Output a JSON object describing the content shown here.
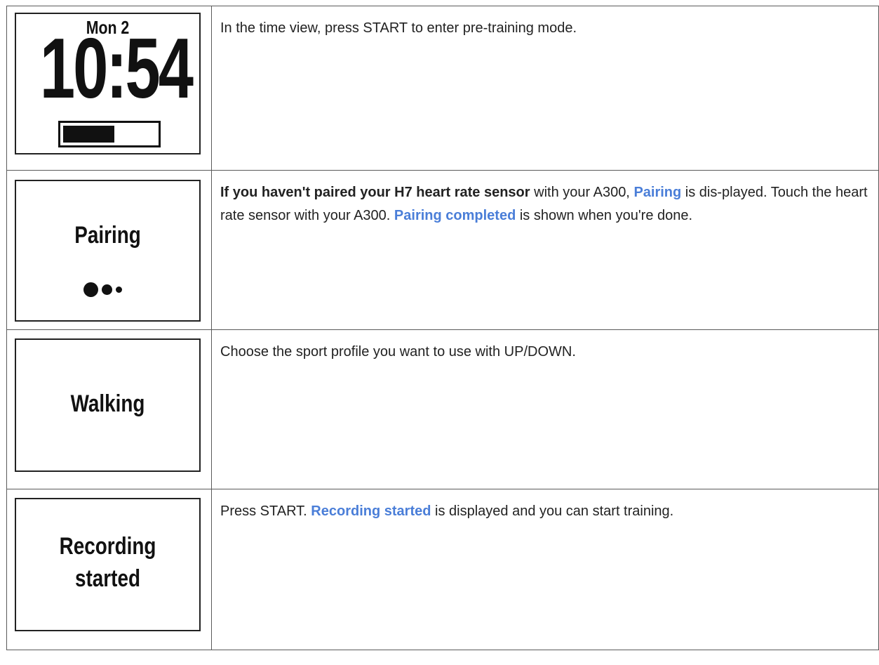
{
  "rows": [
    {
      "screen": {
        "date": "Mon 2",
        "time": "10:54",
        "battery_level": 0.55
      },
      "text": "In the time view, press START to enter pre-training mode."
    },
    {
      "screen": {
        "label": "Pairing",
        "progress_dots": [
          "large",
          "medium",
          "small"
        ]
      },
      "text_parts": {
        "bold_lead": "If you haven't paired your H7 heart rate sensor",
        "t1": " with your A300, ",
        "link1": "Pairing",
        "t2": " is dis-played. Touch the heart rate sensor with your A300. ",
        "link2": "Pairing completed",
        "t3": " is shown when you're done."
      }
    },
    {
      "screen": {
        "label": "Walking"
      },
      "text": "Choose the sport profile you want to use with UP/DOWN."
    },
    {
      "screen": {
        "label_line1": "Recording",
        "label_line2": "started"
      },
      "text_parts": {
        "t1": "Press START. ",
        "link1": "Recording started",
        "t2": " is displayed and you can start training."
      }
    }
  ],
  "colors": {
    "highlight": "#4a7ed8",
    "border": "#5a5a5a",
    "text": "#222222"
  }
}
